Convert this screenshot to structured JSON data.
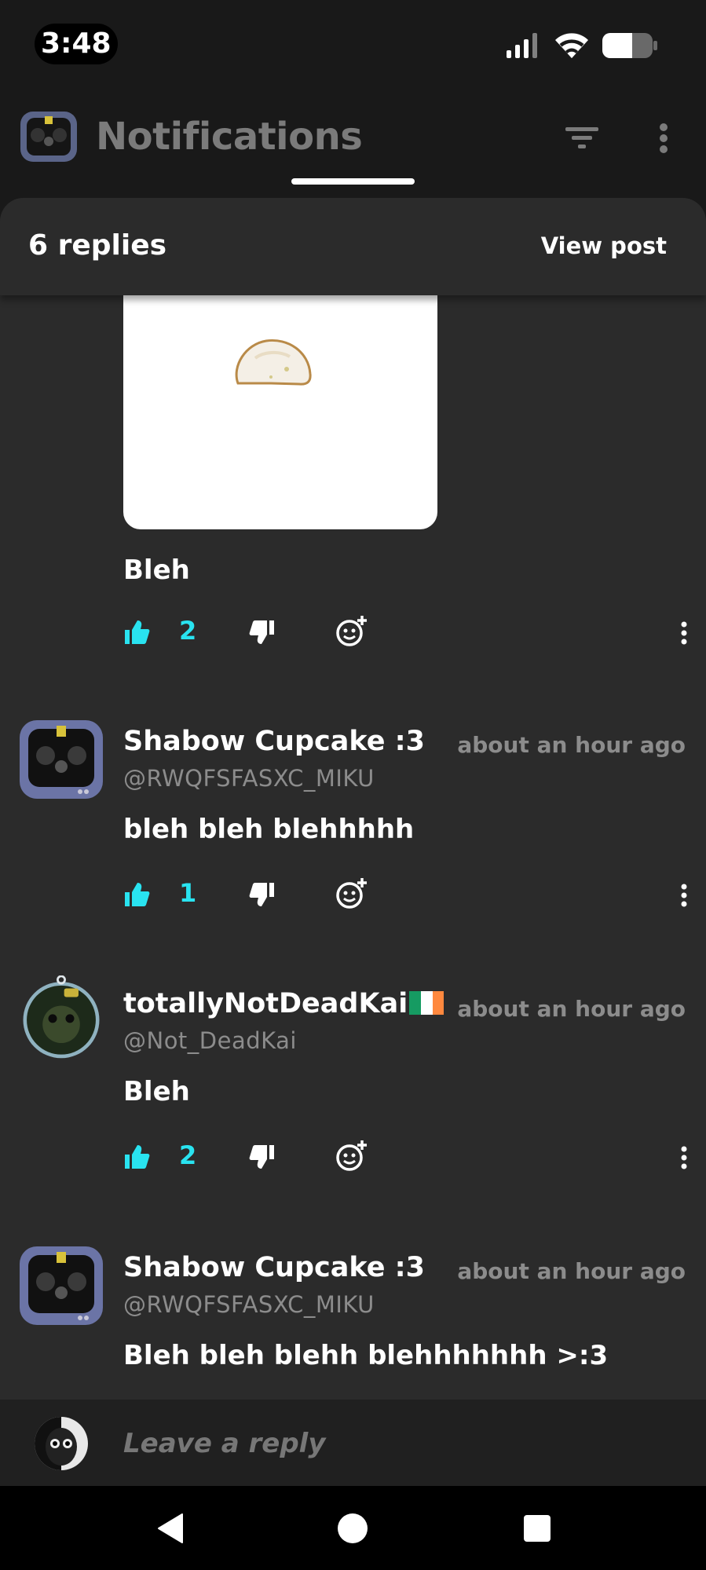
{
  "status_bar": {
    "time": "3:48"
  },
  "app_bar": {
    "title": "Notifications"
  },
  "sheet": {
    "replies_count": "6 replies",
    "view_post_label": "View post"
  },
  "comments": [
    {
      "text": "Bleh",
      "likes": "2"
    },
    {
      "user_name": "Shabow Cupcake :3",
      "handle": "@RWQFSFASXC_MIKU",
      "time": "about an hour ago",
      "text": "bleh bleh blehhhhh",
      "likes": "1"
    },
    {
      "user_name": "totallyNotDeadKai",
      "handle": "@Not_DeadKai",
      "time": "about an hour ago",
      "text": "Bleh",
      "likes": "2"
    },
    {
      "user_name": "Shabow Cupcake :3",
      "handle": "@RWQFSFASXC_MIKU",
      "time": "about an hour ago",
      "text": "Bleh bleh blehh blehhhhhhh >:3"
    }
  ],
  "reply": {
    "placeholder": "Leave a reply"
  },
  "colors": {
    "like_accent": "#29e3f0",
    "flag": [
      "#169b62",
      "#ffffff",
      "#ff883e"
    ]
  }
}
